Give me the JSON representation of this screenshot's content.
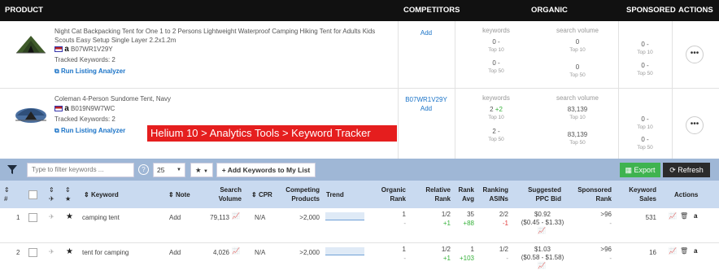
{
  "header": {
    "product": "PRODUCT",
    "competitors": "COMPETITORS",
    "organic": "ORGANIC",
    "sponsored": "SPONSORED",
    "actions": "ACTIONS"
  },
  "products": [
    {
      "title": "Night Cat Backpacking Tent for One 1 to 2 Persons Lightweight Waterproof Camping Hiking Tent for Adults Kids Scouts Easy Setup Single Layer 2.2x1.2m",
      "asin": "B07WR1V29Y",
      "tracked": "Tracked Keywords: 2",
      "run": "Run Listing Analyzer",
      "competitor": "",
      "competitor_add": "Add",
      "kw_label": "keywords",
      "sv_label": "search volume",
      "kw_top10": "0  -",
      "kw_top10_change": "",
      "top10": "Top 10",
      "kw_top50": "0  -",
      "kw_top50_change": "",
      "top50": "Top 50",
      "sv_top10": "0",
      "sv_top50": "0",
      "sp_top10": "0  -",
      "sp_top50": "0  -",
      "more": "•••"
    },
    {
      "title": "Coleman 4-Person Sundome Tent, Navy",
      "asin": "B019N9W7WC",
      "tracked": "Tracked Keywords: 2",
      "run": "Run Listing Analyzer",
      "competitor": "B07WR1V29Y",
      "competitor_add": "Add",
      "kw_label": "keywords",
      "sv_label": "search volume",
      "kw_top10": "2",
      "kw_top10_change": "+2",
      "top10": "Top 10",
      "kw_top50": "2  -",
      "kw_top50_change": "",
      "top50": "Top 50",
      "sv_top10": "83,139",
      "sv_top50": "83,139",
      "sp_top10": "0  -",
      "sp_top50": "0  -",
      "more": "•••"
    }
  ],
  "callout": "Helium 10 > Analytics Tools > Keyword Tracker",
  "toolbar": {
    "filter_placeholder": "Type to filter keywords ...",
    "help": "?",
    "page_size": "25",
    "star": "★",
    "add_keywords": "+ Add Keywords to My List",
    "export": "Export",
    "refresh": "Refresh"
  },
  "columns": {
    "num": "#",
    "keyword": "Keyword",
    "note": "Note",
    "search_volume": "Search Volume",
    "cpr": "CPR",
    "competing": "Competing Products",
    "trend": "Trend",
    "organic_rank": "Organic Rank",
    "relative_rank": "Relative Rank",
    "rank_avg": "Rank Avg",
    "ranking_asins": "Ranking ASINs",
    "ppc": "Suggested PPC Bid",
    "sponsored_rank": "Sponsored Rank",
    "keyword_sales": "Keyword Sales",
    "actions": "Actions"
  },
  "rows": [
    {
      "num": "1",
      "keyword": "camping tent",
      "note": "Add",
      "search_volume": "79,113",
      "cpr": "N/A",
      "competing": ">2,000",
      "organic_rank": "1",
      "organic_change": "-",
      "relative_rank": "1/2",
      "relative_change": "+1",
      "rank_avg": "35",
      "rank_avg_change": "+88",
      "ranking_asins": "2/2",
      "ranking_asins_change": "-1",
      "ppc": "$0.92",
      "ppc_range": "($0.45 - $1.33)",
      "sponsored_rank": ">96",
      "sponsored_change": "-",
      "keyword_sales": "531"
    },
    {
      "num": "2",
      "keyword": "tent for camping",
      "note": "Add",
      "search_volume": "4,026",
      "cpr": "N/A",
      "competing": ">2,000",
      "organic_rank": "1",
      "organic_change": "-",
      "relative_rank": "1/2",
      "relative_change": "+1",
      "rank_avg": "1",
      "rank_avg_change": "+103",
      "ranking_asins": "1/2",
      "ranking_asins_change": "-",
      "ppc": "$1.03",
      "ppc_range": "($0.58 - $1.58)",
      "sponsored_rank": ">96",
      "sponsored_change": "-",
      "keyword_sales": "16"
    }
  ],
  "colors": {
    "header_bg": "#111111",
    "toolbar_bg": "#9fb7d6",
    "column_header_bg": "#c9daf0",
    "link": "#1a73c7",
    "positive": "#36b13a",
    "negative": "#e03a3a",
    "callout": "#e51e1e"
  }
}
